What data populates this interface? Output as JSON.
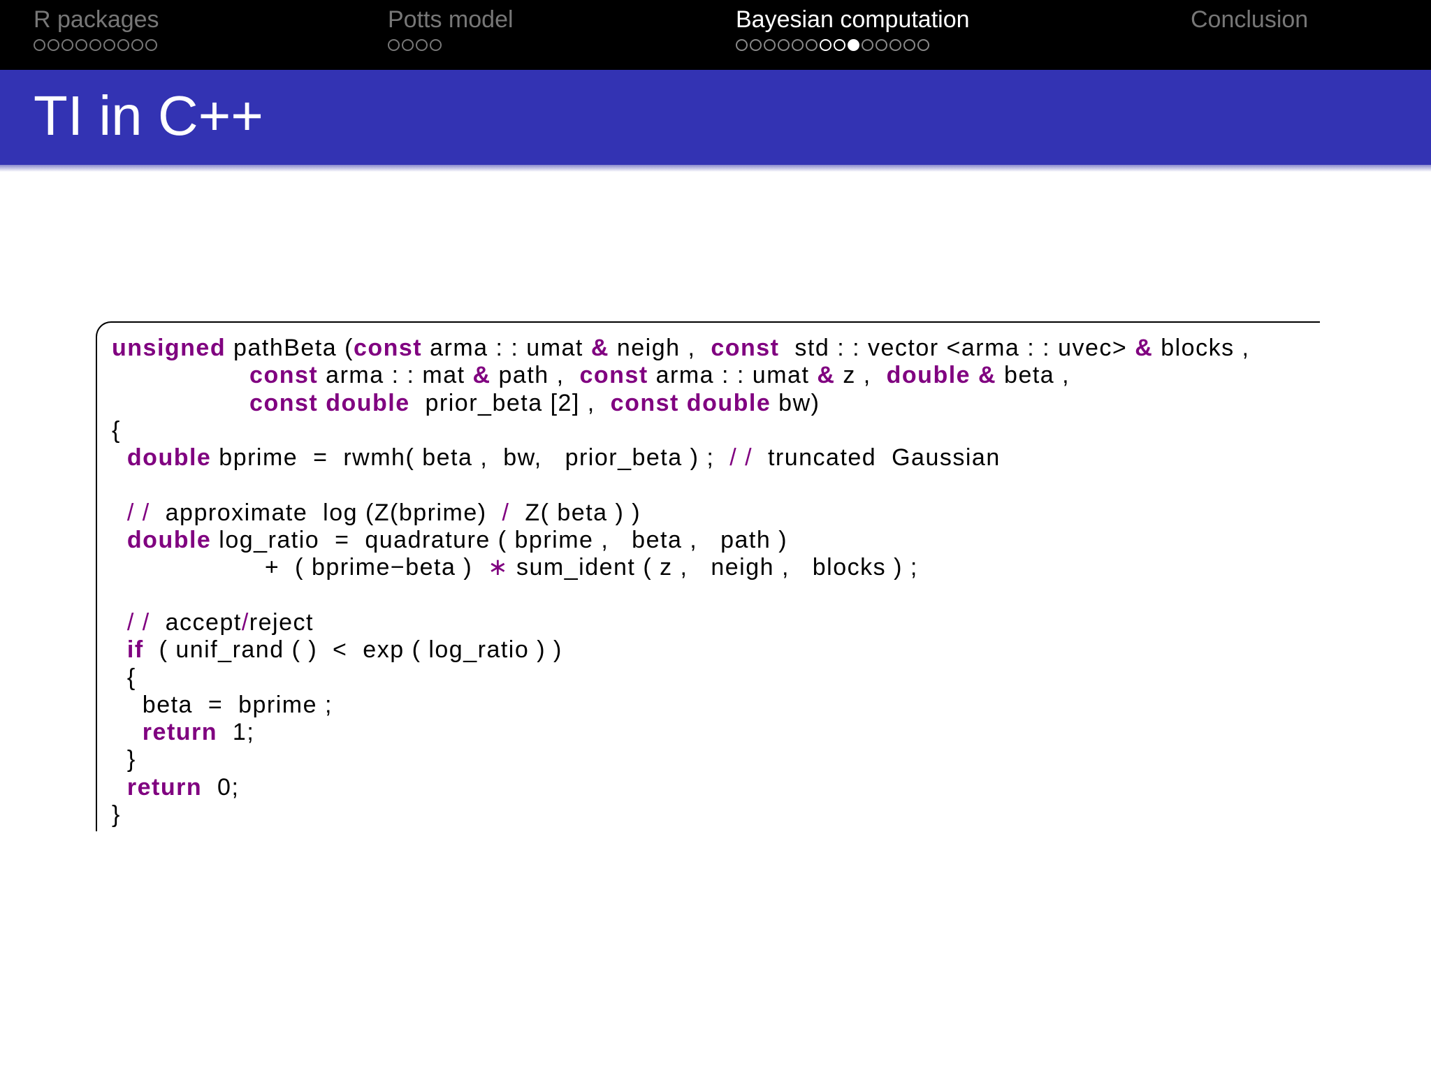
{
  "navigation": {
    "sections": [
      {
        "title": "R packages",
        "dots": 9,
        "active": false
      },
      {
        "title": "Potts model",
        "dots": 4,
        "active": false
      },
      {
        "title": "Bayesian computation",
        "dots": 14,
        "active": true,
        "current_dot": 9
      },
      {
        "title": "Conclusion",
        "dots": 0,
        "active": false
      }
    ]
  },
  "slide": {
    "title": "TI in C++"
  },
  "code": {
    "language": "C++",
    "lines": [
      [
        [
          "kw",
          "unsigned"
        ],
        [
          "t",
          " pathBeta ("
        ],
        [
          "kw",
          "const"
        ],
        [
          "t",
          " arma : : umat "
        ],
        [
          "kw",
          "&"
        ],
        [
          "t",
          " neigh ,  "
        ],
        [
          "kw",
          "const"
        ],
        [
          "t",
          "  std : : vector <arma : : uvec> "
        ],
        [
          "kw",
          "&"
        ],
        [
          "t",
          " blocks ,"
        ]
      ],
      [
        [
          "t",
          "                  "
        ],
        [
          "kw",
          "const"
        ],
        [
          "t",
          " arma : : mat "
        ],
        [
          "kw",
          "&"
        ],
        [
          "t",
          " path ,  "
        ],
        [
          "kw",
          "const"
        ],
        [
          "t",
          " arma : : umat "
        ],
        [
          "kw",
          "&"
        ],
        [
          "t",
          " z ,  "
        ],
        [
          "kw",
          "double"
        ],
        [
          "t",
          " "
        ],
        [
          "kw",
          "&"
        ],
        [
          "t",
          " beta ,"
        ]
      ],
      [
        [
          "t",
          "                  "
        ],
        [
          "kw",
          "const"
        ],
        [
          "t",
          " "
        ],
        [
          "kw",
          "double"
        ],
        [
          "t",
          "  prior_beta [2] ,  "
        ],
        [
          "kw",
          "const"
        ],
        [
          "t",
          " "
        ],
        [
          "kw",
          "double"
        ],
        [
          "t",
          " bw)"
        ]
      ],
      [
        [
          "t",
          "{"
        ]
      ],
      [
        [
          "t",
          "  "
        ],
        [
          "kw",
          "double"
        ],
        [
          "t",
          " bprime  =  rwmh( beta ,  bw,   prior_beta ) ;  "
        ],
        [
          "op",
          "/ /"
        ],
        [
          "t",
          "  truncated  Gaussian"
        ]
      ],
      [
        [
          "t",
          ""
        ]
      ],
      [
        [
          "t",
          "  "
        ],
        [
          "op",
          "/ /"
        ],
        [
          "t",
          "  approximate  log (Z(bprime)  "
        ],
        [
          "op",
          "/"
        ],
        [
          "t",
          "  Z( beta ) )"
        ]
      ],
      [
        [
          "t",
          "  "
        ],
        [
          "kw",
          "double"
        ],
        [
          "t",
          " log_ratio  =  quadrature ( bprime ,   beta ,   path )"
        ]
      ],
      [
        [
          "t",
          "                    +  ( bprime−beta )  "
        ],
        [
          "op",
          "∗"
        ],
        [
          "t",
          " sum_ident ( z ,   neigh ,   blocks ) ;"
        ]
      ],
      [
        [
          "t",
          ""
        ]
      ],
      [
        [
          "t",
          "  "
        ],
        [
          "op",
          "/ /"
        ],
        [
          "t",
          "  accept"
        ],
        [
          "op",
          "/"
        ],
        [
          "t",
          "reject"
        ]
      ],
      [
        [
          "t",
          "  "
        ],
        [
          "kw",
          "if"
        ],
        [
          "t",
          "  ( unif_rand ( )  <  exp ( log_ratio ) )"
        ]
      ],
      [
        [
          "t",
          "  {"
        ]
      ],
      [
        [
          "t",
          "    beta  =  bprime ;"
        ]
      ],
      [
        [
          "t",
          "    "
        ],
        [
          "kw",
          "return"
        ],
        [
          "t",
          "  1;"
        ]
      ],
      [
        [
          "t",
          "  }"
        ]
      ],
      [
        [
          "t",
          "  "
        ],
        [
          "kw",
          "return"
        ],
        [
          "t",
          "  0;"
        ]
      ],
      [
        [
          "t",
          "}"
        ]
      ]
    ]
  },
  "colors": {
    "header_bg": "#000000",
    "titlebar_bg": "#3333b3",
    "keyword": "#800080",
    "inactive_nav": "#777777"
  }
}
